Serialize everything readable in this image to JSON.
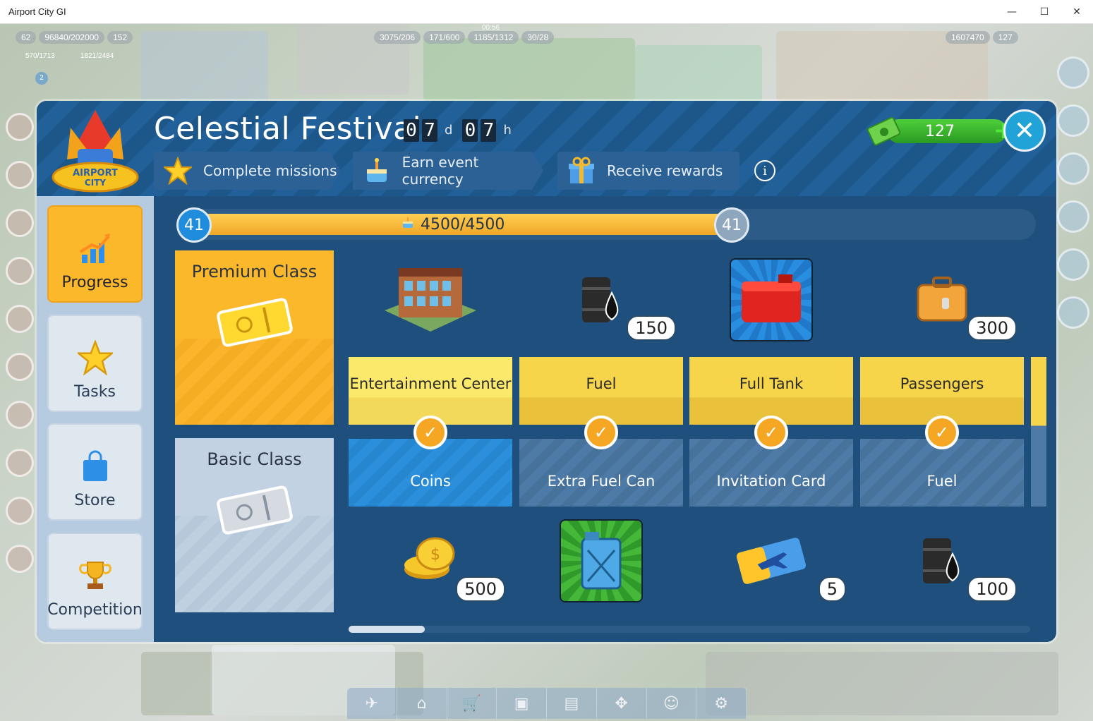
{
  "window": {
    "title": "Airport City GI",
    "minimize": "—",
    "maximize": "☐",
    "close": "✕"
  },
  "hud": {
    "level": "62",
    "xp": "96840/202000",
    "stars": "152",
    "fuel": "3075/206",
    "fuel_timer": "00:56",
    "cargo": "171/600",
    "passengers_cap": "1185/1312",
    "bags": "30/28",
    "coins": "1607470",
    "money": "127",
    "pop": "570/1713",
    "power": "1821/2484",
    "notif": "2"
  },
  "event": {
    "title": "Celestial Festival",
    "timer_days": [
      "0",
      "7"
    ],
    "days_unit": "d",
    "timer_hours": [
      "0",
      "7"
    ],
    "hours_unit": "h",
    "steps": [
      {
        "label": "Complete missions",
        "icon": "star-icon"
      },
      {
        "label": "Earn event currency",
        "icon": "cake-icon"
      },
      {
        "label": "Receive rewards",
        "icon": "gift-icon"
      }
    ],
    "info": "i",
    "currency_value": "127",
    "currency_plus": "+",
    "close": "✕"
  },
  "sidebar": [
    {
      "label": "Progress",
      "icon": "chart-arrow-icon",
      "active": true
    },
    {
      "label": "Tasks",
      "icon": "star-icon",
      "active": false
    },
    {
      "label": "Store",
      "icon": "shopping-bag-icon",
      "active": false
    },
    {
      "label": "Competition",
      "icon": "trophy-icon",
      "active": false
    }
  ],
  "progress": {
    "level_left": "41",
    "level_right": "41",
    "text": "4500/4500",
    "fraction": 1.0
  },
  "classes": {
    "premium": "Premium Class",
    "basic": "Basic Class"
  },
  "rewards": [
    {
      "premium_name": "Entertainment Center",
      "premium_icon": "building-icon",
      "premium_qty": "",
      "basic_name": "Coins",
      "basic_icon": "coins-icon",
      "basic_qty": "500",
      "claimed": true,
      "basic_active": true
    },
    {
      "premium_name": "Fuel",
      "premium_icon": "oil-barrel-icon",
      "premium_qty": "150",
      "basic_name": "Extra Fuel Can",
      "basic_icon": "fuel-can-icon",
      "basic_qty": "",
      "claimed": true,
      "basic_active": false
    },
    {
      "premium_name": "Full Tank",
      "premium_icon": "red-tank-icon",
      "premium_qty": "",
      "basic_name": "Invitation Card",
      "basic_icon": "plane-ticket-icon",
      "basic_qty": "5",
      "claimed": true,
      "basic_active": false
    },
    {
      "premium_name": "Passengers",
      "premium_icon": "suitcase-icon",
      "premium_qty": "300",
      "basic_name": "Fuel",
      "basic_icon": "oil-barrel-icon",
      "basic_qty": "100",
      "claimed": true,
      "basic_active": false
    }
  ],
  "colors": {
    "modal_bg": "#1f4f7c",
    "premium": "#fcb82b",
    "basic": "#c2d2e3",
    "accent_green": "#4fcf3c",
    "check": "#f5a623"
  }
}
